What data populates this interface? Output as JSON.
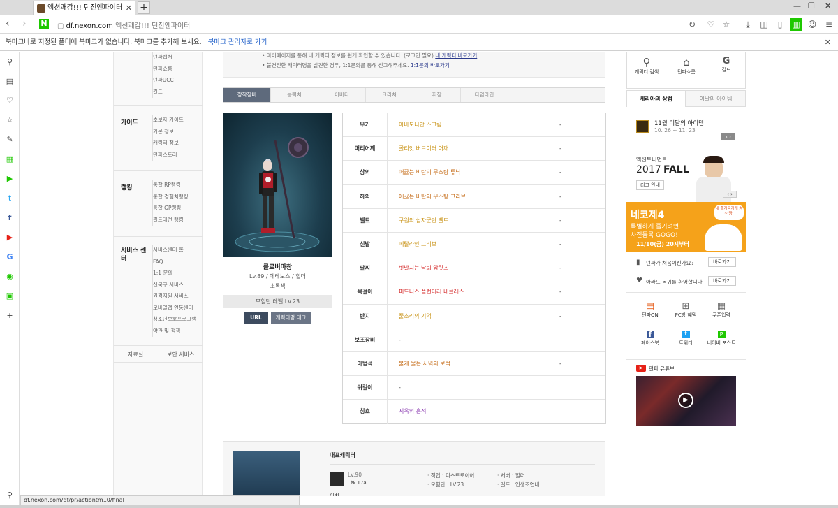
{
  "browser": {
    "tab_title": "액션쾌감!!! 던전앤파이터",
    "url_domain": "df.nexon.com",
    "url_title": "액션쾌감!!! 던전앤파이터",
    "bookmark_msg": "북마크바로 지정된 폴더에 북마크가 없습니다. 북마크를 추가해 보세요.",
    "bookmark_link": "북마크 관리자로 가기",
    "status_url": "df.nexon.com/df/pr/actiontm10/final"
  },
  "leftnav": {
    "top_items": [
      "던파캡처",
      "던파쇼룸",
      "던파UCC",
      "길드"
    ],
    "groups": [
      {
        "title": "가이드",
        "items": [
          "초보자 가이드",
          "기본 정보",
          "캐릭터 정보",
          "던파스토리"
        ]
      },
      {
        "title": "랭킹",
        "items": [
          "통합 RP랭킹",
          "통합 경험치랭킹",
          "통합 GP랭킹",
          "길드대전 랭킹"
        ]
      },
      {
        "title": "서비스 센터",
        "items": [
          "서비스센터 홈",
          "FAQ",
          "1:1 문의",
          "신북구 서비스",
          "원격지원 서비스",
          "모바일앱 연동센터",
          "청소년보호프로그램",
          "약관 및 정책"
        ]
      }
    ],
    "footer": [
      "자료실",
      "보안 서비스"
    ]
  },
  "notice": {
    "line1": "• 마이페이지를 통해 내 캐릭터 정보를 쉽게 확인할 수 있습니다. (로그인 필요)",
    "line1_link": "내 캐릭터 바로가기",
    "line2": "• 불건전한 캐릭터명을 발견한 경우, 1:1문의를 통해 신고해주세요.",
    "line2_link": "1:1문의 바로가기"
  },
  "tabs": [
    "장착장비",
    "능력치",
    "아바타",
    "크리쳐",
    "휘장",
    "타임라인"
  ],
  "character": {
    "name": "클로버마창",
    "info": "Lv.89 / 에레보스 / 힐더",
    "class": "초록색",
    "guild_level": "모험단 레벨 Lv.23",
    "btn_url": "URL",
    "btn_tag": "캐릭터명 태그"
  },
  "equipment": [
    {
      "slot": "무기",
      "item": "아바도니안 스크림",
      "color": "#c89214",
      "extra": "-"
    },
    {
      "slot": "머리어깨",
      "item": "골리앗 버드이터 어깨",
      "color": "#c89214",
      "extra": "-"
    },
    {
      "slot": "상의",
      "item": "애끓는 비탄의 무스탕 튜닉",
      "color": "#c46a14",
      "extra": "-"
    },
    {
      "slot": "하의",
      "item": "애끓는 비탄의 무스탕 그리브",
      "color": "#c46a14",
      "extra": "-"
    },
    {
      "slot": "벨트",
      "item": "구원의 십자군단 벨트",
      "color": "#c89214",
      "extra": "-"
    },
    {
      "slot": "신발",
      "item": "메탈라인 그리브",
      "color": "#c89214",
      "extra": "-"
    },
    {
      "slot": "팔찌",
      "item": "빗발치는 낙뢰 암릿츠",
      "color": "#d42a2a",
      "extra": "-"
    },
    {
      "slot": "목걸이",
      "item": "퍼드니스 플런더러 네클레스",
      "color": "#d42a2a",
      "extra": "-"
    },
    {
      "slot": "반지",
      "item": "풀소리의 기억",
      "color": "#c89214",
      "extra": "-"
    },
    {
      "slot": "보조장비",
      "item": "-",
      "color": "#333333",
      "extra": ""
    },
    {
      "slot": "마법석",
      "item": "붉게 물든 서녘의 보석",
      "color": "#c46a14",
      "extra": "-"
    },
    {
      "slot": "귀걸이",
      "item": "-",
      "color": "#333333",
      "extra": ""
    },
    {
      "slot": "칭호",
      "item": "지옥의 흔적",
      "color": "#8a3ab0",
      "extra": ""
    }
  ],
  "rep": {
    "title": "대표캐릭터",
    "lv": "Lv.90",
    "no": "№.17a",
    "job": "· 직업 : 디스트로이어",
    "server": "· 서버 : 힐더",
    "guild_lv": "· 모험단 : LV.23",
    "guild": "· 길드 : 인생조연네",
    "sub": "이치"
  },
  "right": {
    "icons": [
      "캐릭터 검색",
      "던파쇼룸",
      "길드"
    ],
    "tab_active": "세리아의 상점",
    "tab_other": "이달의 아이템",
    "month_title": "11월 이달의 아이템",
    "month_date": "10. 26 ~ 11. 23",
    "fall_small": "액션토너먼트",
    "fall_year": "2017",
    "fall_word": "FALL",
    "league_btn": "리그 안내",
    "promo_title": "네코제4",
    "promo_l1": "특별하게 즐기려면",
    "promo_l2": "사전등록 GOGO!",
    "promo_date": "11/10(금) 20시부터",
    "promo_bubble": "네 즐거움가게 쳐~ 쨩!",
    "q1": "던파가 처음이신가요?",
    "q2": "아라드 복귀를 환영합니다",
    "goto": "바로가기",
    "grid": [
      "던파ON",
      "PC방 혜택",
      "쿠폰입력",
      "페이스북",
      "트위터",
      "네이버 포스트"
    ],
    "yt": "던파 유튜브"
  }
}
